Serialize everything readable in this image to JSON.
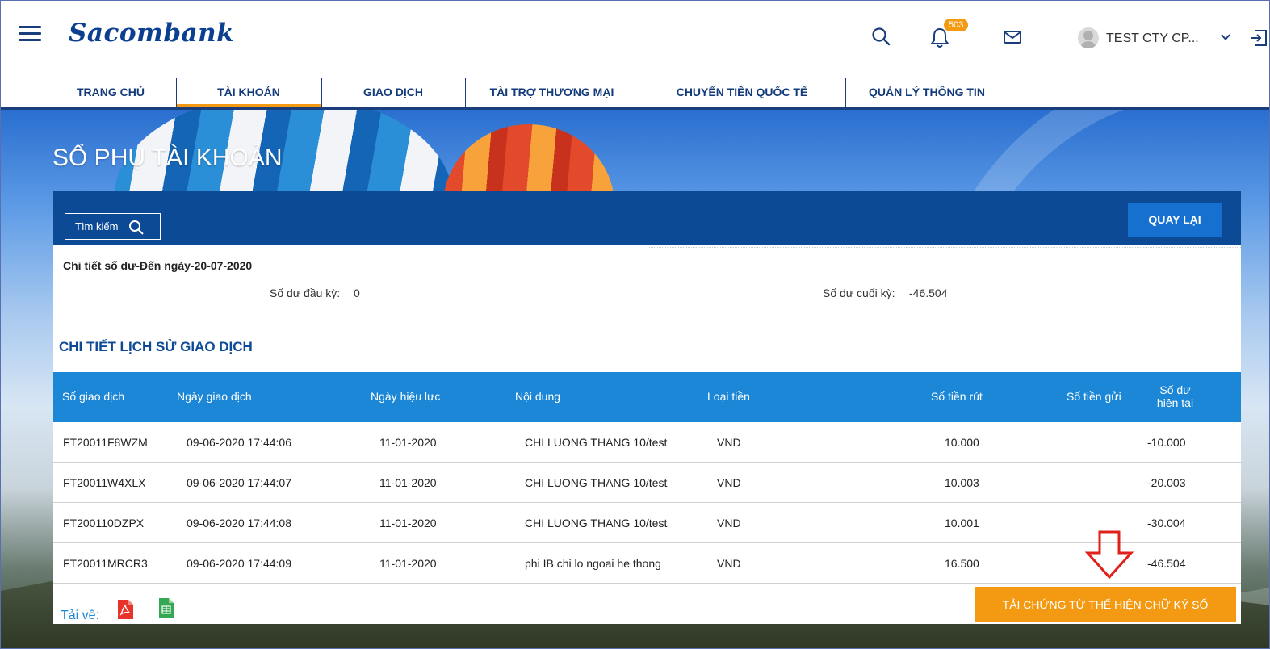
{
  "header": {
    "logo": "Sacombank",
    "notification_count": "503",
    "user_name": "TEST CTY CP...",
    "icons": [
      "menu-icon",
      "search-icon",
      "bell-icon",
      "mail-icon",
      "avatar",
      "chevron-down-icon",
      "logout-icon"
    ]
  },
  "nav": {
    "items": [
      {
        "label": "TRANG CHỦ"
      },
      {
        "label": "TÀI KHOẢN"
      },
      {
        "label": "GIAO DỊCH"
      },
      {
        "label": "TÀI TRỢ THƯƠNG MẠI"
      },
      {
        "label": "CHUYỂN TIỀN QUỐC TẾ"
      },
      {
        "label": "QUẢN LÝ THÔNG TIN"
      }
    ],
    "active": "TÀI KHOẢN"
  },
  "page": {
    "title": "SỔ PHỤ TÀI KHOẢN",
    "search_label": "Tìm kiếm",
    "back_label": "QUAY LẠI"
  },
  "summary": {
    "title": "Chi tiết số dư-Đến ngày-20-07-2020",
    "open_label": "Số dư đầu kỳ:",
    "open_value": "0",
    "close_label": "Số dư cuối kỳ:",
    "close_value": "-46.504"
  },
  "history": {
    "title": "CHI TIẾT LỊCH SỬ GIAO DỊCH",
    "columns": {
      "txn_no": "Số giao dịch",
      "txn_date": "Ngày giao dịch",
      "effective_date": "Ngày hiệu lực",
      "content": "Nội dung",
      "currency": "Loại tiền",
      "withdraw": "Số tiền rút",
      "deposit": "Số tiền gửi",
      "balance_1": "Số dư",
      "balance_2": "hiện tại"
    },
    "rows": [
      {
        "txn_no": "FT20011F8WZM",
        "txn_date": "09-06-2020 17:44:06",
        "effective_date": "11-01-2020",
        "content": "CHI LUONG THANG 10/test",
        "currency": "VND",
        "withdraw": "10.000",
        "deposit": "",
        "balance": "-10.000"
      },
      {
        "txn_no": "FT20011W4XLX",
        "txn_date": "09-06-2020 17:44:07",
        "effective_date": "11-01-2020",
        "content": "CHI LUONG THANG 10/test",
        "currency": "VND",
        "withdraw": "10.003",
        "deposit": "",
        "balance": "-20.003"
      },
      {
        "txn_no": "FT200110DZPX",
        "txn_date": "09-06-2020 17:44:08",
        "effective_date": "11-01-2020",
        "content": "CHI LUONG THANG 10/test",
        "currency": "VND",
        "withdraw": "10.001",
        "deposit": "",
        "balance": "-30.004"
      },
      {
        "txn_no": "FT20011MRCR3",
        "txn_date": "09-06-2020 17:44:09",
        "effective_date": "11-01-2020",
        "content": "phi IB chi lo ngoai he thong",
        "currency": "VND",
        "withdraw": "16.500",
        "deposit": "",
        "balance": "-46.504"
      }
    ]
  },
  "download": {
    "label": "Tải về:",
    "icons": [
      "pdf-icon",
      "excel-icon"
    ]
  },
  "sign_button": "TẢI CHỨNG TỪ THỂ HIỆN CHỮ KÝ SỐ",
  "colors": {
    "brand_navy": "#0d4a95",
    "table_header": "#1c87d6",
    "accent_orange": "#f39a12",
    "annotation_red": "#e0201a"
  }
}
